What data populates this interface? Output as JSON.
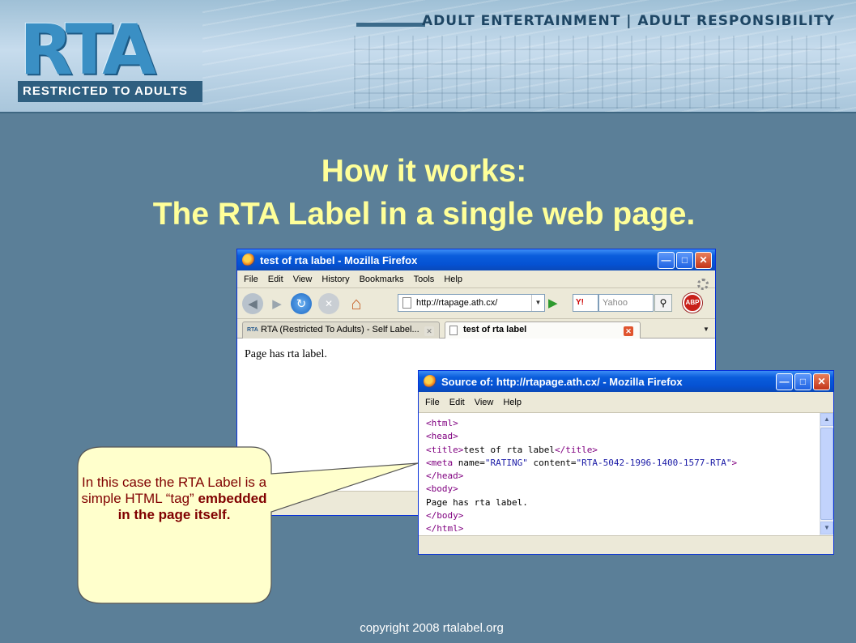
{
  "banner": {
    "logo_text": "RTA",
    "logo_sub": "RESTRICTED TO ADULTS",
    "tagline": "ADULT ENTERTAINMENT | ADULT RESPONSIBILITY"
  },
  "slide": {
    "title_line1": "How it works:",
    "title_line2": "The RTA Label in a single web page."
  },
  "browser": {
    "title": "test of rta label - Mozilla Firefox",
    "menu": [
      "File",
      "Edit",
      "View",
      "History",
      "Bookmarks",
      "Tools",
      "Help"
    ],
    "url": "http://rtapage.ath.cx/",
    "search_engine": "Y!",
    "search_placeholder": "Yahoo",
    "abp_label": "ABP",
    "tabs": [
      {
        "icon": "RTA",
        "label": "RTA (Restricted To Adults) - Self Label..."
      },
      {
        "label": "test of rta label"
      }
    ],
    "page_text": "Page has rta label."
  },
  "source_window": {
    "title": "Source of: http://rtapage.ath.cx/ - Mozilla Firefox",
    "menu": [
      "File",
      "Edit",
      "View",
      "Help"
    ],
    "lines": {
      "l1": "<html>",
      "l2": "<head>",
      "l3_open": "<title>",
      "l3_text": "test of rta label",
      "l3_close": "</title>",
      "l4_tag": "<meta",
      "l4_attr1": " name=",
      "l4_val1": "\"RATING\"",
      "l4_attr2": " content=",
      "l4_val2": "\"RTA-5042-1996-1400-1577-RTA\"",
      "l4_end": ">",
      "l5": "</head>",
      "l6": "<body>",
      "l7": "Page has rta label.",
      "l8": "</body>",
      "l9": "</html>"
    }
  },
  "callout": {
    "text_plain": "In this case the RTA Label is a simple HTML “tag”",
    "text_bold": "embedded in the page itself."
  },
  "footer": {
    "copyright": "copyright 2008 rtalabel.org"
  },
  "colors": {
    "background": "#5b7f98",
    "title": "#ffff99",
    "callout_fill": "#ffffcc",
    "callout_text": "#800000"
  }
}
